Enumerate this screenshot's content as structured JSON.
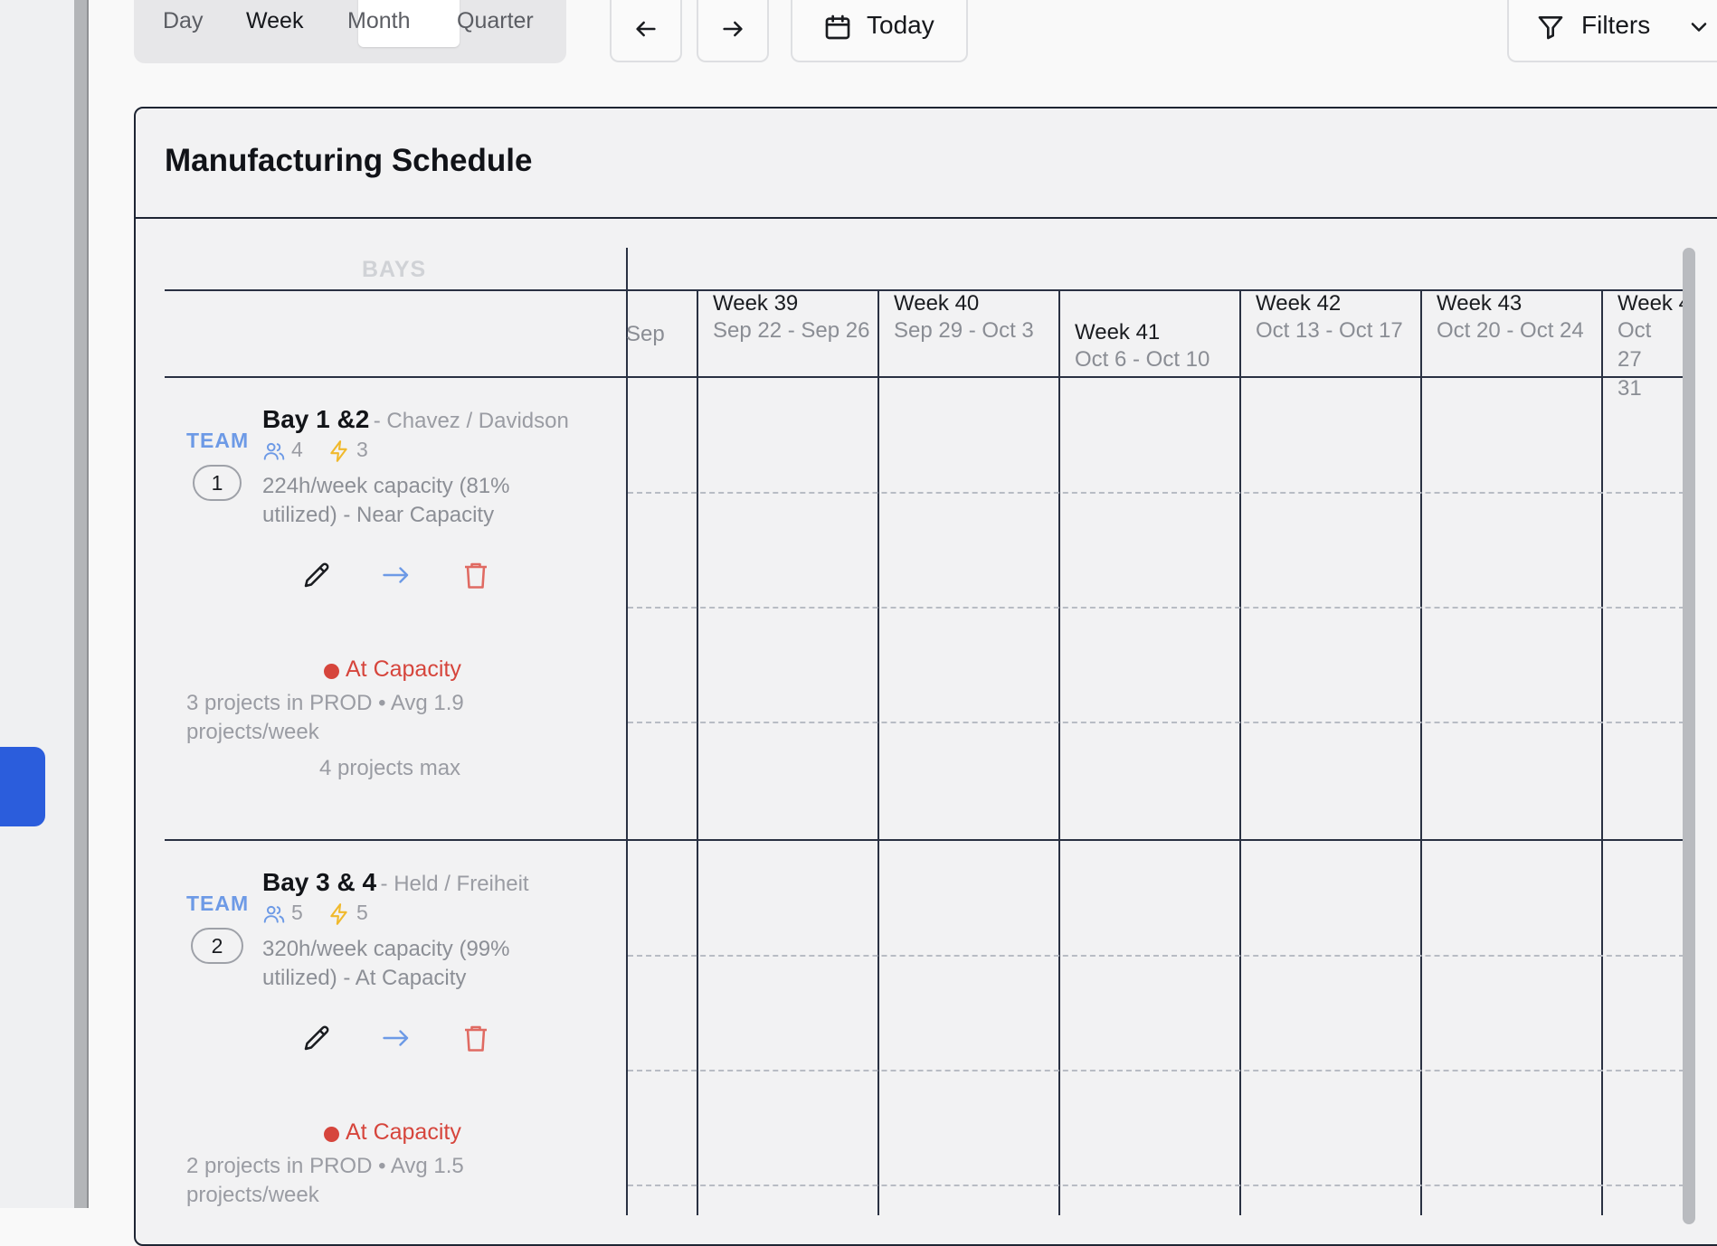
{
  "view_switcher": {
    "options": [
      "Day",
      "Week",
      "Month",
      "Quarter"
    ],
    "selected": "Week"
  },
  "toolbar": {
    "prev_icon": "arrow-left-icon",
    "next_icon": "arrow-right-icon",
    "today_label": "Today",
    "filters_label": "Filters"
  },
  "panel": {
    "title": "Manufacturing Schedule",
    "bays_header": "BAYS"
  },
  "timeline": {
    "partial_prev": "Sep",
    "weeks": [
      {
        "title": "Week 39",
        "range": "Sep 22 - Sep 26"
      },
      {
        "title": "Week 40",
        "range": "Sep 29 - Oct 3"
      },
      {
        "title": "Week 41",
        "range": "Oct 6 - Oct 10"
      },
      {
        "title": "Week 42",
        "range": "Oct 13 - Oct 17"
      },
      {
        "title": "Week 43",
        "range": "Oct 20 - Oct 24"
      },
      {
        "title": "Week 4",
        "range": "Oct 27 31"
      }
    ]
  },
  "bays": [
    {
      "team_label": "TEAM",
      "team_number": "1",
      "name": "Bay 1 &2",
      "leads": "- Chavez / Davidson",
      "staff": "4",
      "power": "3",
      "capacity": "224h/week capacity (81% utilized) - Near Capacity",
      "status": "At Capacity",
      "projects": "3 projects in PROD • Avg 1.9 projects/week",
      "max": "4 projects max"
    },
    {
      "team_label": "TEAM",
      "team_number": "2",
      "name": "Bay 3 & 4",
      "leads": "- Held / Freiheit",
      "staff": "5",
      "power": "5",
      "capacity": "320h/week capacity (99% utilized) - At Capacity",
      "status": "At Capacity",
      "projects": "2 projects in PROD • Avg 1.5 projects/week"
    }
  ],
  "colors": {
    "accent": "#2b5ddc",
    "team": "#6d9ae6",
    "status_red": "#d6453c",
    "power_yellow": "#f0b92c",
    "edit": "#1a1c20"
  }
}
